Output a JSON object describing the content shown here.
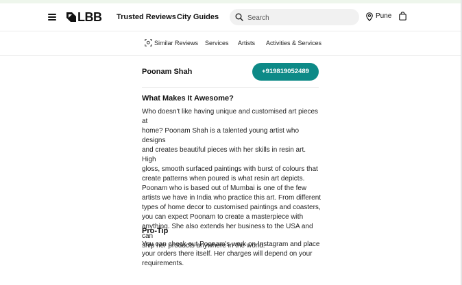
{
  "header": {
    "brand": "LBB",
    "nav": [
      "Trusted Reviews",
      "City Guides"
    ],
    "search_placeholder": "Search",
    "location": "Pune"
  },
  "subnav": {
    "items": [
      "Similar Reviews",
      "Services",
      "Artists",
      "Activities & Services"
    ]
  },
  "profile": {
    "name": "Poonam Shah",
    "phone": "+919819052489"
  },
  "content": {
    "awesome_title": "What Makes It Awesome?",
    "awesome_lines": [
      "Who doesn't like having unique and customised art pieces at",
      "home? Poonam Shah is a talented young artist who designs",
      "and creates beautiful pieces with her skills in resin art. High",
      "gloss, smooth surfaced paintings with burst of colours that",
      "create patterns when poured is what resin art depicts.",
      "Poonam who is based out of Mumbai is one of the few",
      "artists we have in India who practice this art. From different",
      "types of home decor to customised paintings and coasters,",
      "you can expect Poonam to create a masterpiece with",
      "anything. She also extends her business to the USA and can",
      "ship her products anywhere in the world."
    ],
    "protip_title": "Pro-Tip",
    "protip_lines": [
      "You can check out Poonam's work on Instagram and place",
      "your orders there itself. Her charges will depend on your",
      "requirements."
    ]
  },
  "colors": {
    "accent": "#0d8a87",
    "topstrip": "#eef6ec"
  },
  "icons": [
    "menu-icon",
    "lbb-logo-icon",
    "search-icon",
    "location-pin-icon",
    "shopping-bag-icon",
    "similar-reviews-icon"
  ]
}
